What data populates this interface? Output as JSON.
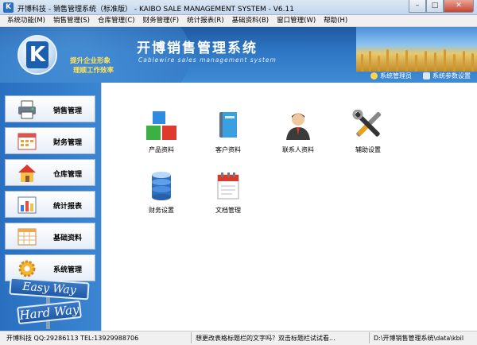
{
  "window": {
    "title": "开博科技 - 销售管理系统（标准版） - KAIBO SALE MANAGEMENT SYSTEM - V6.11",
    "minimize": "–",
    "maximize": "□",
    "close": "✕"
  },
  "menu": [
    "系统功能(M)",
    "销售管理(S)",
    "仓库管理(C)",
    "财务管理(F)",
    "统计报表(R)",
    "基础资料(B)",
    "窗口管理(W)",
    "帮助(H)"
  ],
  "header": {
    "logo_letter": "K",
    "slogan_1": "提升企业形象",
    "slogan_2": "理顺工作效率",
    "brand_cn": "开博销售管理系统",
    "brand_en": "Cablewire sales management system",
    "links": [
      "系统管理员",
      "系统参数设置"
    ]
  },
  "sidebar": {
    "items": [
      {
        "label": "销售管理",
        "icon": "printer-icon"
      },
      {
        "label": "财务管理",
        "icon": "calendar-icon"
      },
      {
        "label": "仓库管理",
        "icon": "house-icon"
      },
      {
        "label": "统计报表",
        "icon": "bar-chart-icon"
      },
      {
        "label": "基础资料",
        "icon": "spreadsheet-icon"
      },
      {
        "label": "系统管理",
        "icon": "gear-icon"
      }
    ],
    "sign_1": "Easy Way",
    "sign_2": "Hard Way"
  },
  "main": {
    "tiles": [
      {
        "label": "产品资料",
        "icon": "product-blocks-icon"
      },
      {
        "label": "客户资料",
        "icon": "book-icon"
      },
      {
        "label": "联系人资料",
        "icon": "person-icon"
      },
      {
        "label": "辅助设置",
        "icon": "tools-icon"
      },
      {
        "label": "财务设置",
        "icon": "database-icon"
      },
      {
        "label": "文档管理",
        "icon": "document-icon"
      }
    ]
  },
  "status": {
    "left": "开博科技 QQ:29286113 TEL:13929988706",
    "mid": "想更改表格标题栏的文字吗？双击标题栏试试看...",
    "right": "D:\\开博销售管理系统\\data\\kbil"
  },
  "colors": {
    "header_blue": "#2e77c4",
    "slogan_yellow": "#ffe35a"
  }
}
